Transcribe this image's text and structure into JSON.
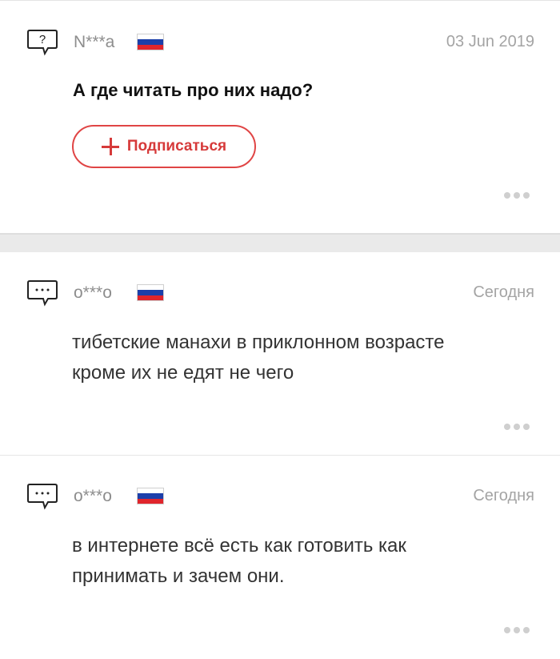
{
  "question": {
    "author": "N***a",
    "date": "03 Jun 2019",
    "text": "А где читать про них надо?",
    "subscribe_label": "Подписаться",
    "icon": "question-bubble-icon"
  },
  "answers": [
    {
      "author": "о***о",
      "date": "Сегодня",
      "lines": [
        "тибетские манахи в приклонном возрасте",
        "кроме их не едят не чего"
      ],
      "icon": "comment-bubble-icon"
    },
    {
      "author": "о***о",
      "date": "Сегодня",
      "lines": [
        "в интернете всё есть как готовить как",
        "принимать и зачем они."
      ],
      "icon": "comment-bubble-icon"
    }
  ],
  "colors": {
    "accent": "#e04545",
    "flag_white": "#ffffff",
    "flag_blue": "#1c3faa",
    "flag_red": "#e0252c"
  }
}
